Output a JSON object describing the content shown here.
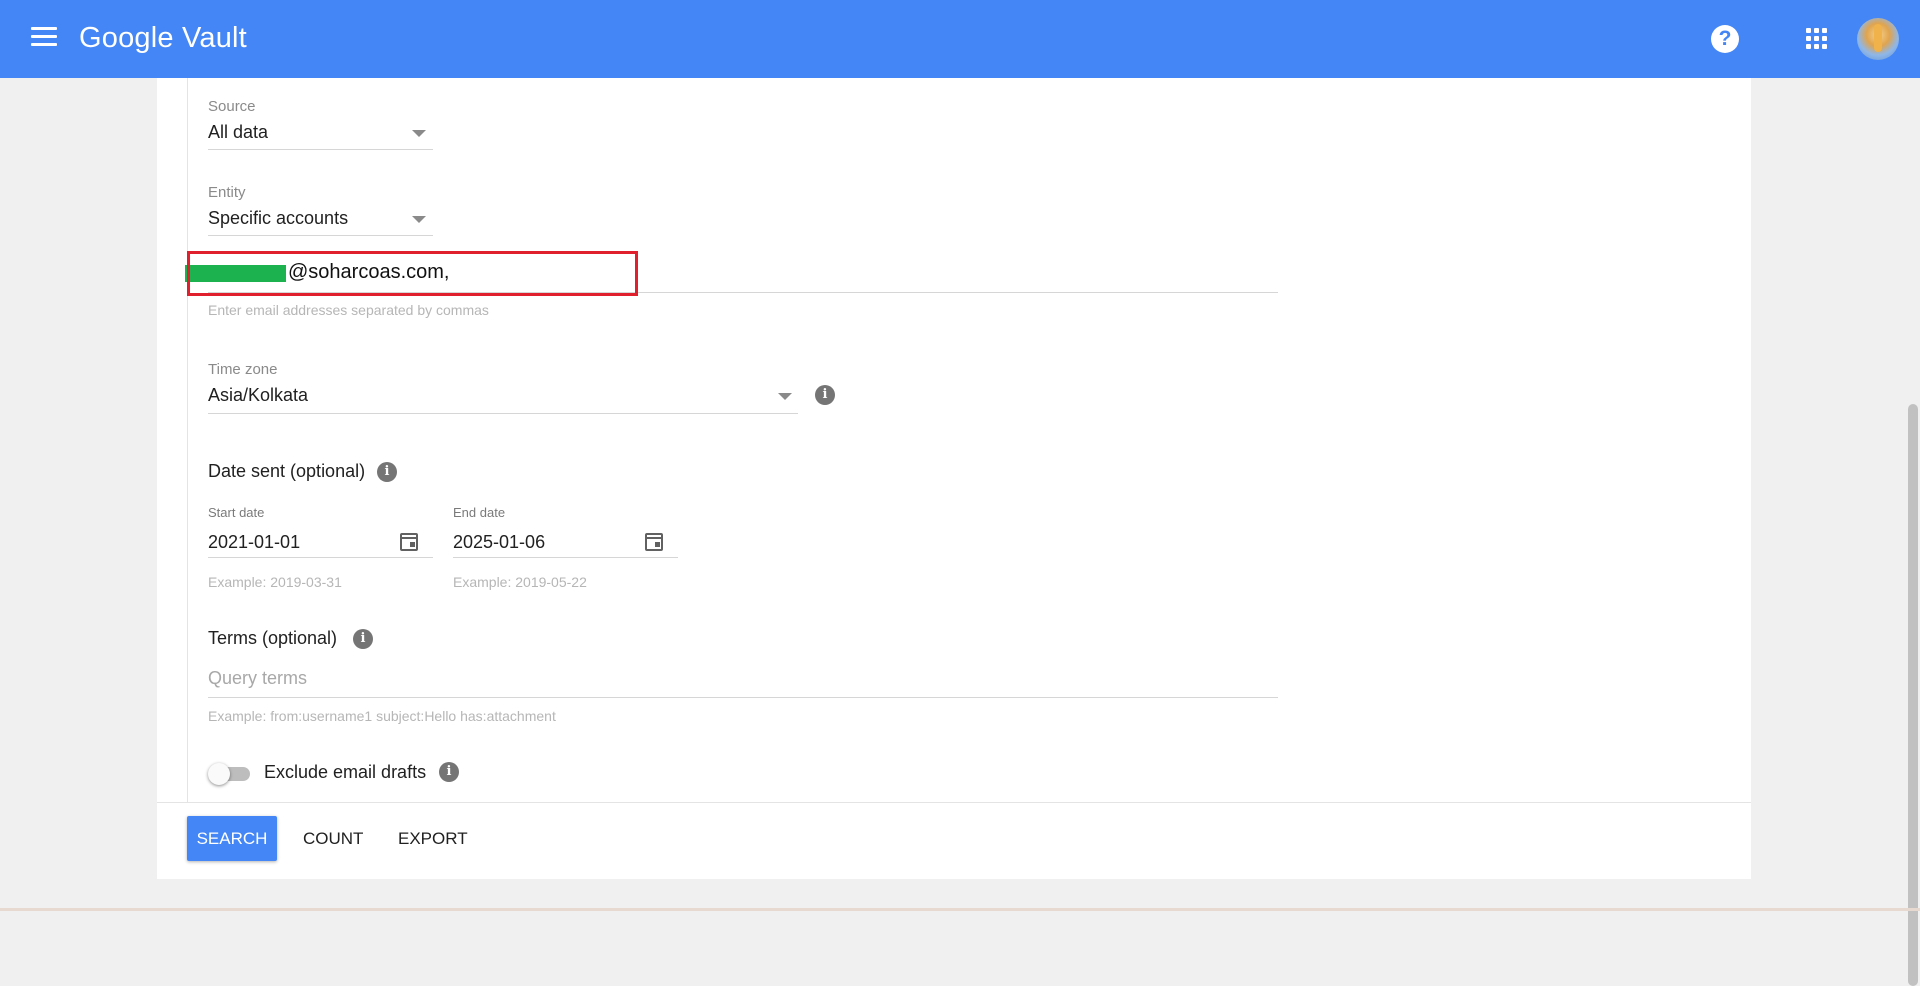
{
  "appbar": {
    "title": "Google Vault",
    "icons": [
      "menu-icon",
      "help-icon",
      "apps-icon",
      "avatar"
    ]
  },
  "form": {
    "source": {
      "label": "Source",
      "value": "All data"
    },
    "entity": {
      "label": "Entity",
      "value": "Specific accounts"
    },
    "accounts": {
      "email_suffix": "@soharcoas.com,",
      "hint": "Enter email addresses separated by commas"
    },
    "timezone": {
      "label": "Time zone",
      "value": "Asia/Kolkata"
    },
    "date_sent": {
      "title": "Date sent (optional)",
      "start": {
        "label": "Start date",
        "value": "2021-01-01",
        "hint": "Example: 2019-03-31"
      },
      "end": {
        "label": "End date",
        "value": "2025-01-06",
        "hint": "Example: 2019-05-22"
      }
    },
    "terms": {
      "title": "Terms (optional)",
      "placeholder": "Query terms",
      "hint": "Example: from:username1 subject:Hello has:attachment"
    },
    "exclude_drafts": {
      "label": "Exclude email drafts",
      "enabled": false
    }
  },
  "actions": {
    "search": "SEARCH",
    "count": "COUNT",
    "export": "EXPORT"
  },
  "colors": {
    "appbar": "#4486f5",
    "highlight": "#e0202c",
    "redaction": "#1bb24f"
  }
}
